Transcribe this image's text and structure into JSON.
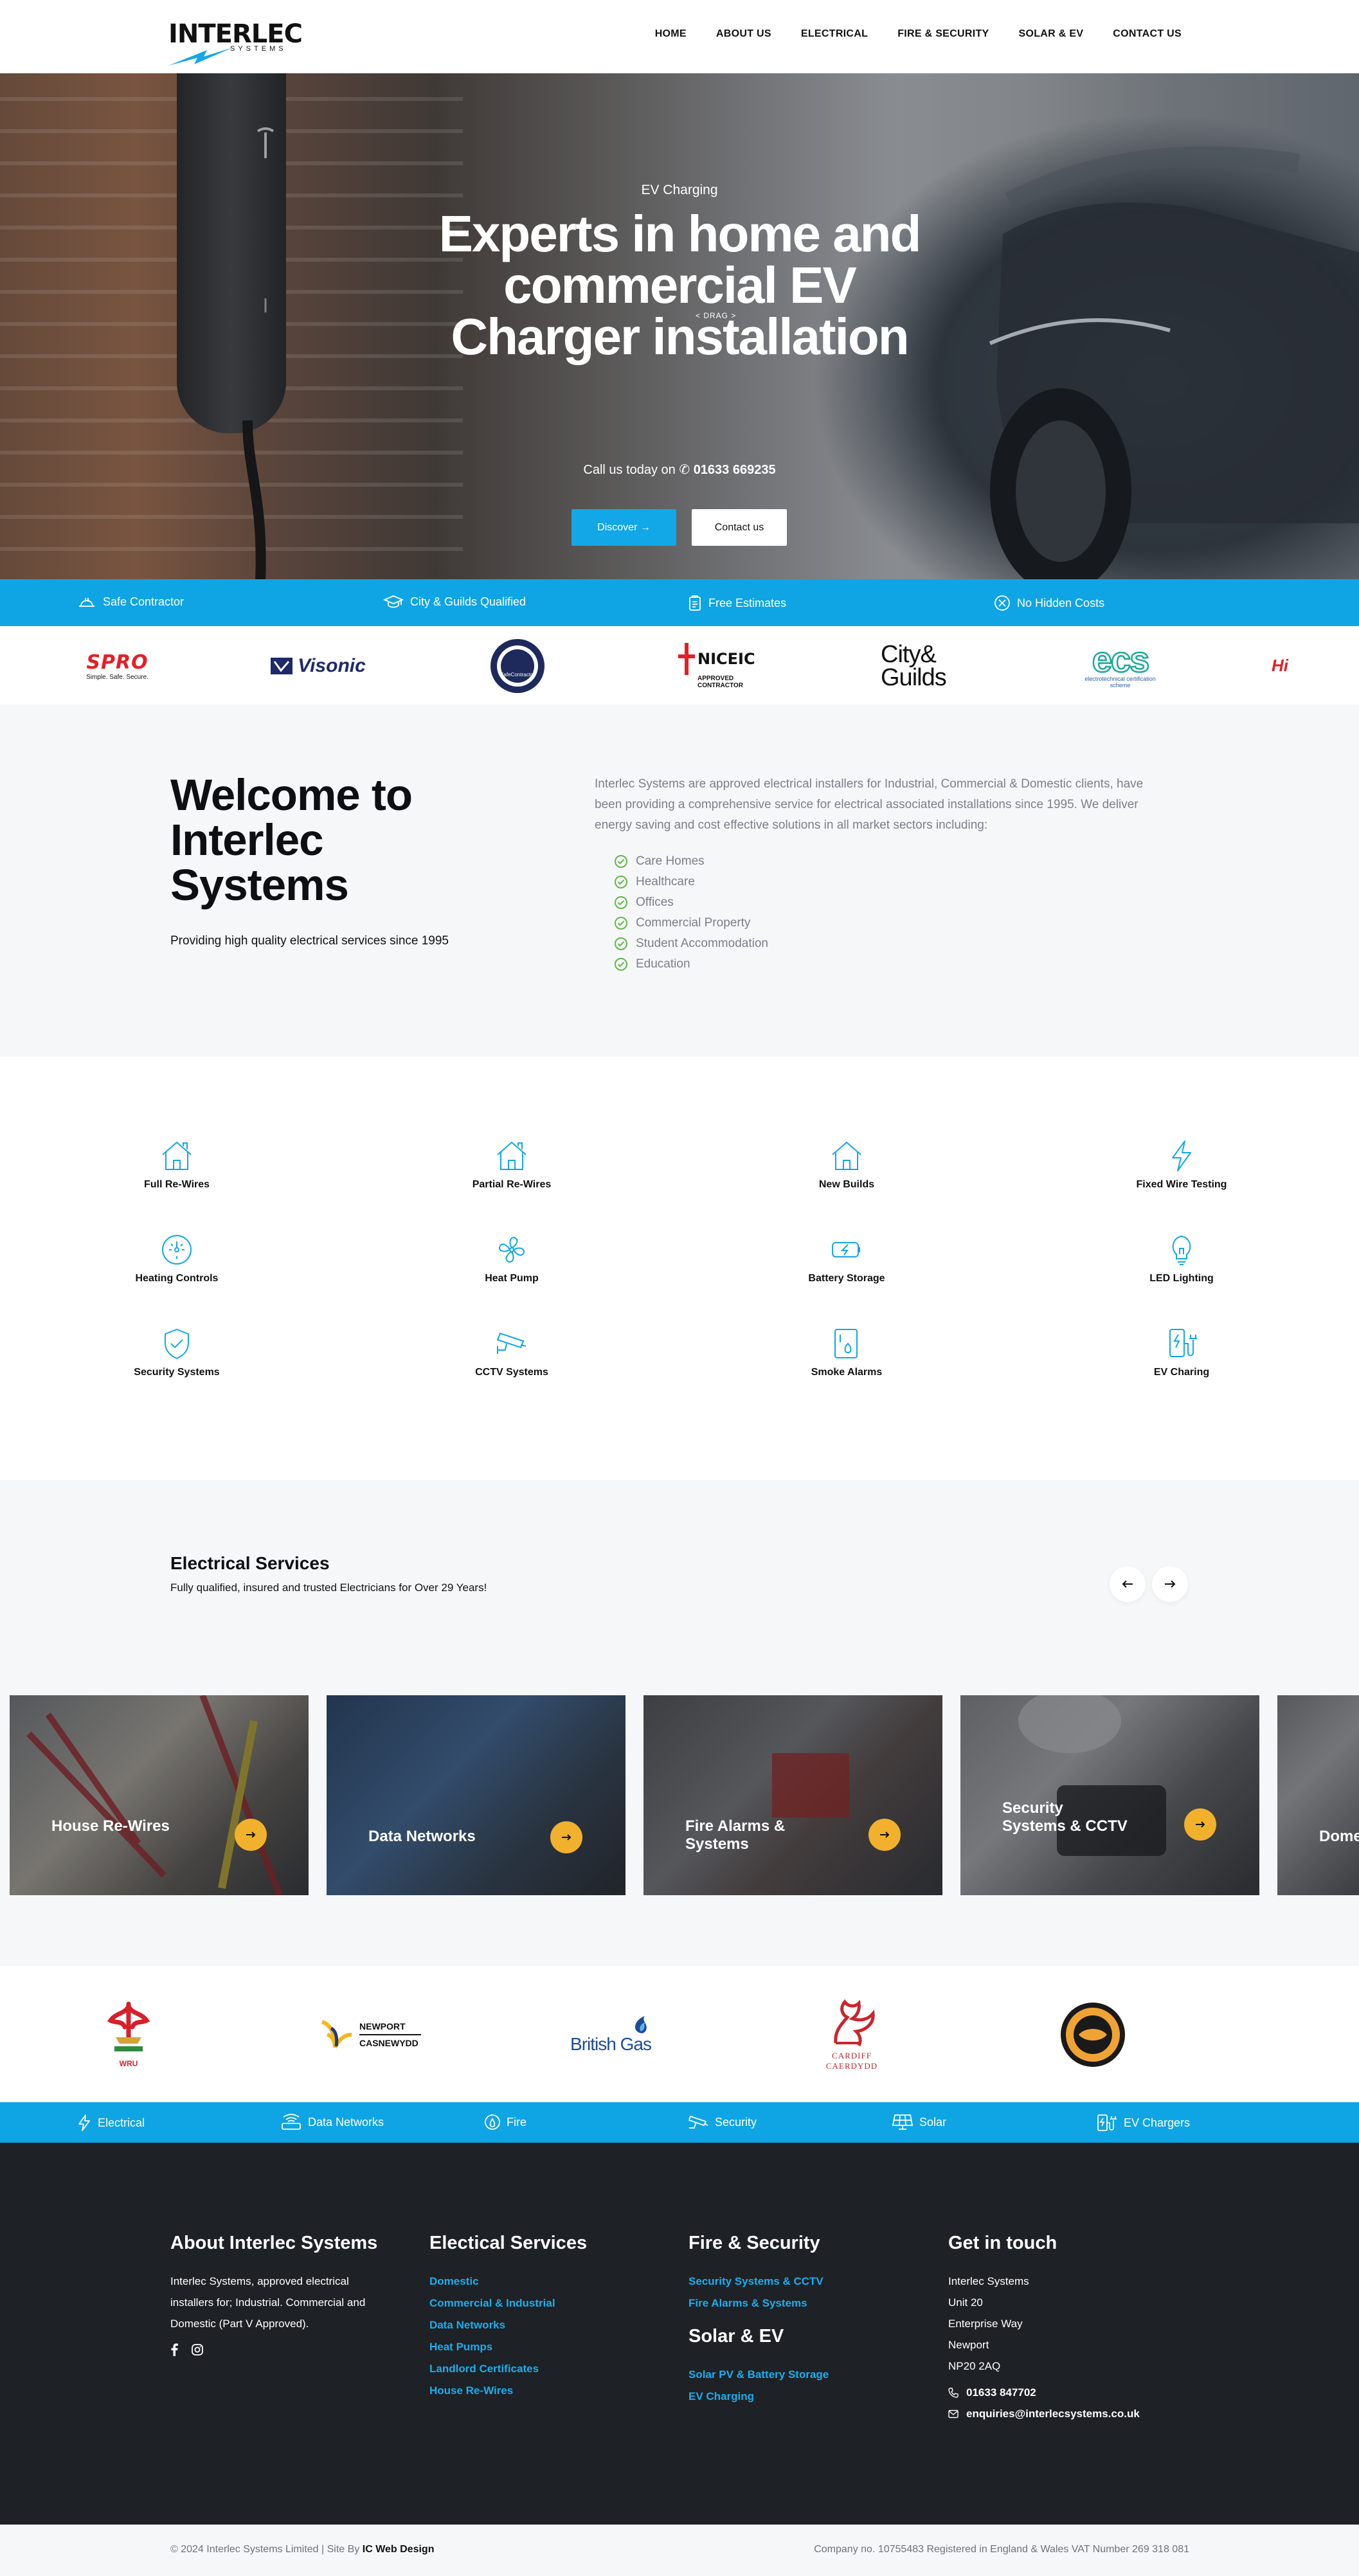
{
  "brand": {
    "name": "INTERLEC",
    "tagline": "SYSTEMS"
  },
  "nav": [
    "HOME",
    "ABOUT US",
    "ELECTRICAL",
    "FIRE & SECURITY",
    "SOLAR & EV",
    "CONTACT US"
  ],
  "hero": {
    "eyebrow": "EV Charging",
    "title": "Experts in home and commercial EV Charger installation",
    "drag_hint": "< DRAG >",
    "phone_prefix": "Call us today on",
    "phone": "01633 669235",
    "discover_label": "Discover →",
    "contact_label": "Contact us",
    "slides": 3,
    "active_slide": 3
  },
  "features": [
    "Safe Contractor",
    "City & Guilds Qualified",
    "Free Estimates",
    "No Hidden Costs"
  ],
  "accreditations": {
    "spro": "SPRO",
    "spro_tag": "Simple. Safe. Secure.",
    "visonic": "Visonic",
    "safecontractor": "SafeContractor",
    "niceic": "NICEIC",
    "niceic_sub": "APPROVED CONTRACTOR",
    "cityguilds_1": "City&",
    "cityguilds_2": "Guilds",
    "ecs": "ecs",
    "ecs_sub": "electrotechnical certification scheme",
    "partial": "Hi"
  },
  "welcome": {
    "title": "Welcome to Interlec Systems",
    "tagline": "Providing high quality electrical services since 1995",
    "intro": "Interlec Systems are approved electrical installers for Industrial, Commercial & Domestic clients, have been providing a comprehensive service for electrical associated installations since 1995. We deliver energy saving and cost effective solutions in all market sectors including:",
    "sectors": [
      "Care Homes",
      "Healthcare",
      "Offices",
      "Commercial Property",
      "Student Accommodation",
      "Education"
    ]
  },
  "services": [
    "Full Re-Wires",
    "Partial Re-Wires",
    "New Builds",
    "Fixed Wire Testing",
    "Heating Controls",
    "Heat Pump",
    "Battery Storage",
    "LED Lighting",
    "Security Systems",
    "CCTV Systems",
    "Smoke Alarms",
    "EV Charing"
  ],
  "carousel": {
    "title": "Electrical Services",
    "subtitle": "Fully qualified, insured and trusted Electricians for Over 29 Years!",
    "cards": [
      "House Re-Wires",
      "Data Networks",
      "Fire Alarms & Systems",
      "Security Systems & CCTV",
      "Dome"
    ]
  },
  "partners": {
    "wru": "WRU",
    "newport_1": "NEWPORT",
    "newport_2": "CASNEWYDD",
    "british_gas": "British Gas",
    "cardiff_1": "CARDIFF",
    "cardiff_2": "CAERDYDD"
  },
  "categories": [
    "Electrical",
    "Data Networks",
    "Fire",
    "Security",
    "Solar",
    "EV Chargers"
  ],
  "footer": {
    "about_title": "About Interlec Systems",
    "about_text": "Interlec Systems, approved electrical installers for; Industrial. Commercial and Domestic (Part V Approved).",
    "electrical_title": "Electical Services",
    "electrical_links": [
      "Domestic",
      "Commercial & Industrial",
      "Data Networks",
      "Heat Pumps",
      "Landlord Certificates",
      "House Re-Wires"
    ],
    "fire_title": "Fire & Security",
    "fire_links": [
      "Security Systems & CCTV",
      "Fire Alarms & Systems"
    ],
    "solar_title": "Solar & EV",
    "solar_links": [
      "Solar PV & Battery Storage",
      "EV Charging"
    ],
    "contact_title": "Get in touch",
    "address": [
      "Interlec Systems",
      "Unit 20",
      "Enterprise Way",
      "Newport",
      "NP20 2AQ"
    ],
    "phone": "01633 847702",
    "email": "enquiries@interlecsystems.co.uk"
  },
  "bottom": {
    "copyright": "© 2024 Interlec Systems Limited | Site By",
    "site_by": "IC Web Design",
    "company": "Company no. 10755483 Registered in England & Wales VAT Number 269 318 081"
  },
  "colors": {
    "accent": "#0fa5e5",
    "link": "#19aef0",
    "cta": "#f1b12d",
    "footer": "#1e2125",
    "check": "#5fb946"
  }
}
